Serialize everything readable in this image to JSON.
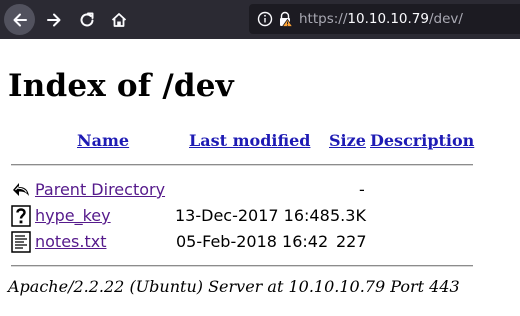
{
  "browser": {
    "url_scheme": "https://",
    "url_host": "10.10.10.79",
    "url_path": "/dev/"
  },
  "page": {
    "title": "Index of /dev",
    "columns": {
      "name": "Name",
      "last_modified": "Last modified",
      "size": "Size",
      "description": "Description"
    },
    "rows": [
      {
        "icon": "parent-dir-icon",
        "name": "Parent Directory",
        "last_modified": "",
        "size": "-",
        "description": ""
      },
      {
        "icon": "unknown-file-icon",
        "name": "hype_key",
        "last_modified": "13-Dec-2017 16:48",
        "size": "5.3K",
        "description": ""
      },
      {
        "icon": "text-file-icon",
        "name": "notes.txt",
        "last_modified": "05-Feb-2018 16:42",
        "size": "227",
        "description": ""
      }
    ],
    "footer": "Apache/2.2.22 (Ubuntu) Server at 10.10.10.79 Port 443"
  },
  "colors": {
    "toolbar_bg": "#2b2a33",
    "urlbar_bg": "#1c1b22",
    "header_link": "#1e1bb4",
    "visited_link": "#551a8b"
  }
}
